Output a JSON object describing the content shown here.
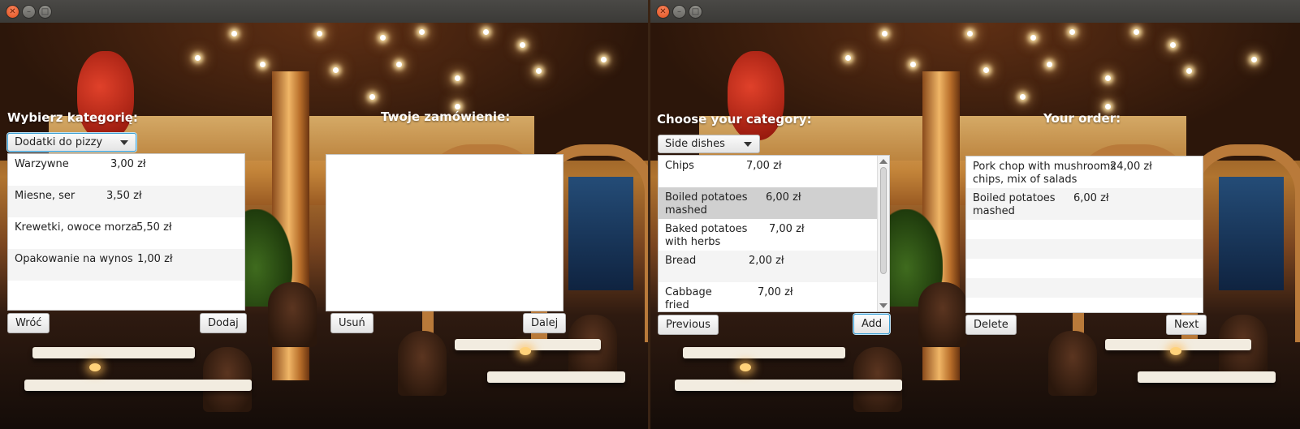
{
  "left": {
    "category_heading": "Wybierz kategorię:",
    "order_heading": "Twoje zamówienie:",
    "category_selected": "Dodatki do pizzy",
    "menu_items": [
      {
        "name": "Warzywne",
        "price": "3,00 zł"
      },
      {
        "name": "Miesne, ser",
        "price": "3,50 zł"
      },
      {
        "name": "Krewetki, owoce morza",
        "price": "5,50 zł"
      },
      {
        "name": "Opakowanie na wynos",
        "price": "1,00 zł"
      }
    ],
    "buttons": {
      "back": "Wróć",
      "add": "Dodaj",
      "delete": "Usuń",
      "next": "Dalej"
    }
  },
  "right": {
    "category_heading": "Choose your category:",
    "order_heading": "Your order:",
    "category_selected": "Side dishes",
    "menu_items": [
      {
        "name": "Chips",
        "price": "7,00 zł"
      },
      {
        "name": "Boiled potatoes mashed",
        "price": "6,00 zł"
      },
      {
        "name": "Baked potatoes with herbs",
        "price": "7,00 zł"
      },
      {
        "name": "Bread",
        "price": "2,00 zł"
      },
      {
        "name": "Cabbage fried",
        "price": "7,00 zł"
      }
    ],
    "selected_index": 1,
    "order_items": [
      {
        "name": "Pork chop with mushrooms",
        "price": "24,00 zł",
        "extra": "chips, mix of salads"
      },
      {
        "name": "Boiled potatoes mashed",
        "price": "6,00 zł"
      }
    ],
    "buttons": {
      "previous": "Previous",
      "add": "Add",
      "delete": "Delete",
      "next": "Next"
    }
  },
  "icons": {
    "close": "close-icon",
    "minimize": "minimize-icon",
    "maximize": "maximize-icon"
  },
  "colors": {
    "focus_border": "#3da1d6",
    "selected_row": "#d0d0d0",
    "titlebar": "#3b3a37"
  }
}
